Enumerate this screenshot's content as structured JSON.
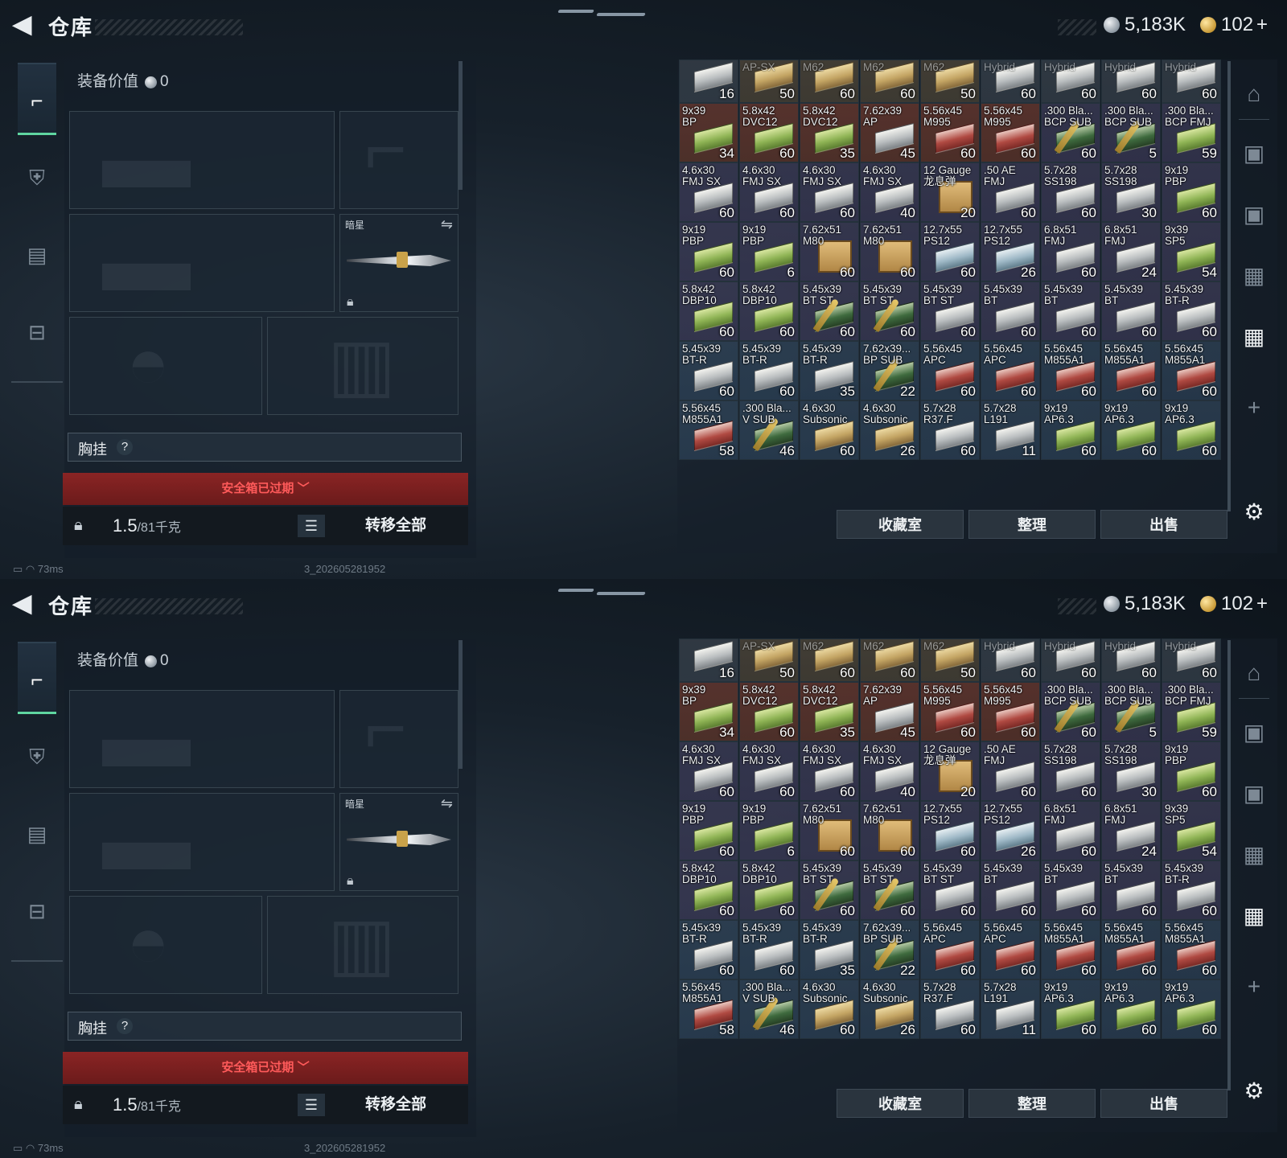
{
  "header": {
    "back_label": "<",
    "title": "仓库",
    "silver": "5,183K",
    "gold": "102",
    "plus": "+"
  },
  "nav": {
    "items": [
      "pistol-icon",
      "armor-icon",
      "backpack-icon",
      "case-icon"
    ]
  },
  "loadout": {
    "value_label": "装备价值",
    "value": "0",
    "melee_label": "暗星",
    "chest_label": "胸挂",
    "chest_help": "?",
    "expired": "安全箱已过期",
    "weight": "1.5",
    "weight_max": "/81千克",
    "move_all": "转移全部"
  },
  "stash": {
    "buttons": [
      "收藏室",
      "整理",
      "出售"
    ],
    "rows": [
      [
        [
          "",
          "16",
          "white",
          "gray"
        ],
        [
          "AP-SX",
          "50",
          "tan",
          "tan"
        ],
        [
          "M62",
          "60",
          "tan",
          "tan"
        ],
        [
          "M62",
          "60",
          "tan",
          "tan"
        ],
        [
          "M62",
          "50",
          "tan",
          "tan"
        ],
        [
          "Hybrid",
          "60",
          "white",
          "gray"
        ],
        [
          "Hybrid",
          "60",
          "white",
          "gray"
        ],
        [
          "Hybrid",
          "60",
          "white",
          "gray"
        ],
        [
          "Hybrid",
          "60",
          "white",
          "gray"
        ]
      ],
      [
        [
          "9x39\nBP",
          "34",
          "green",
          "red"
        ],
        [
          "5.8x42\nDVC12",
          "60",
          "green",
          "red"
        ],
        [
          "5.8x42\nDVC12",
          "35",
          "green",
          "red"
        ],
        [
          "7.62x39\nAP",
          "45",
          "white",
          "red"
        ],
        [
          "5.56x45\nM995",
          "60",
          "red",
          "red"
        ],
        [
          "5.56x45\nM995",
          "60",
          "red",
          "red"
        ],
        [
          ".300 Bla...\nBCP SUB",
          "60",
          "dgreen",
          "purple"
        ],
        [
          ".300 Bla...\nBCP SUB",
          "5",
          "dgreen",
          "purple"
        ],
        [
          ".300 Bla...\nBCP FMJ",
          "59",
          "green",
          "purple"
        ]
      ],
      [
        [
          "4.6x30\nFMJ SX",
          "60",
          "white",
          "purple"
        ],
        [
          "4.6x30\nFMJ SX",
          "60",
          "white",
          "purple"
        ],
        [
          "4.6x30\nFMJ SX",
          "60",
          "white",
          "purple"
        ],
        [
          "4.6x30\nFMJ SX",
          "40",
          "white",
          "purple"
        ],
        [
          "12 Gauge\n龙息弹",
          "20",
          "crate",
          "purple"
        ],
        [
          ".50 AE\nFMJ",
          "60",
          "white",
          "purple"
        ],
        [
          "5.7x28\nSS198",
          "60",
          "white",
          "purple"
        ],
        [
          "5.7x28\nSS198",
          "30",
          "white",
          "purple"
        ],
        [
          "9x19\nPBP",
          "60",
          "green",
          "purple"
        ]
      ],
      [
        [
          "9x19\nPBP",
          "60",
          "green",
          "purple"
        ],
        [
          "9x19\nPBP",
          "6",
          "green",
          "purple"
        ],
        [
          "7.62x51\nM80",
          "60",
          "crate",
          "purple"
        ],
        [
          "7.62x51\nM80",
          "60",
          "crate",
          "purple"
        ],
        [
          "12.7x55\nPS12",
          "60",
          "blue",
          "purple"
        ],
        [
          "12.7x55\nPS12",
          "26",
          "blue",
          "purple"
        ],
        [
          "6.8x51\nFMJ",
          "60",
          "white",
          "purple"
        ],
        [
          "6.8x51\nFMJ",
          "24",
          "white",
          "purple"
        ],
        [
          "9x39\nSP5",
          "54",
          "green",
          "purple"
        ]
      ],
      [
        [
          "5.8x42\nDBP10",
          "60",
          "green",
          "purple"
        ],
        [
          "5.8x42\nDBP10",
          "60",
          "green",
          "purple"
        ],
        [
          "5.45x39\nBT ST",
          "60",
          "dgreen",
          "purple"
        ],
        [
          "5.45x39\nBT ST",
          "60",
          "dgreen",
          "purple"
        ],
        [
          "5.45x39\nBT ST",
          "60",
          "white",
          "purple"
        ],
        [
          "5.45x39\nBT",
          "60",
          "white",
          "purple"
        ],
        [
          "5.45x39\nBT",
          "60",
          "white",
          "purple"
        ],
        [
          "5.45x39\nBT",
          "60",
          "white",
          "purple"
        ],
        [
          "5.45x39\nBT-R",
          "60",
          "white",
          "purple"
        ]
      ],
      [
        [
          "5.45x39\nBT-R",
          "60",
          "white",
          "blue"
        ],
        [
          "5.45x39\nBT-R",
          "60",
          "white",
          "blue"
        ],
        [
          "5.45x39\nBT-R",
          "35",
          "white",
          "blue"
        ],
        [
          "7.62x39...\nBP SUB",
          "22",
          "dgreen",
          "blue"
        ],
        [
          "5.56x45\nAPC",
          "60",
          "red",
          "blue"
        ],
        [
          "5.56x45\nAPC",
          "60",
          "red",
          "blue"
        ],
        [
          "5.56x45\nM855A1",
          "60",
          "red",
          "blue"
        ],
        [
          "5.56x45\nM855A1",
          "60",
          "red",
          "blue"
        ],
        [
          "5.56x45\nM855A1",
          "60",
          "red",
          "blue"
        ]
      ],
      [
        [
          "5.56x45\nM855A1",
          "58",
          "red",
          "blue"
        ],
        [
          ".300 Bla...\nV SUB",
          "46",
          "dgreen",
          "blue"
        ],
        [
          "4.6x30\nSubsonic",
          "60",
          "tan",
          "blue"
        ],
        [
          "4.6x30\nSubsonic",
          "26",
          "tan",
          "blue"
        ],
        [
          "5.7x28\nR37.F",
          "60",
          "white",
          "blue"
        ],
        [
          "5.7x28\nL191",
          "11",
          "white",
          "blue"
        ],
        [
          "9x19\nAP6.3",
          "60",
          "green",
          "blue"
        ],
        [
          "9x19\nAP6.3",
          "60",
          "green",
          "blue"
        ],
        [
          "9x19\nAP6.3",
          "60",
          "green",
          "blue"
        ]
      ]
    ]
  },
  "status": {
    "ping": "73ms",
    "build": "3_202605281952"
  },
  "colors": {
    "accent": "#5fd6a0",
    "danger": "#8a2424",
    "danger_text": "#ff5a5a"
  }
}
